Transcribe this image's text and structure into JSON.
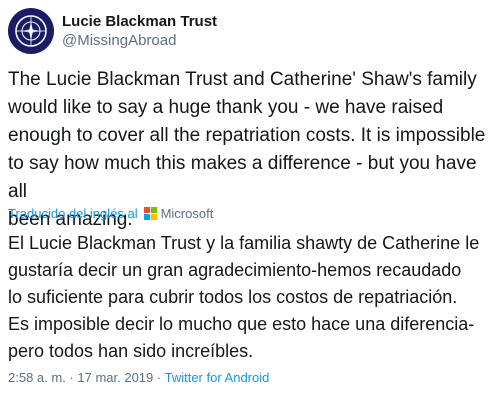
{
  "account": {
    "display_name": "Lucie Blackman Trust",
    "handle": "@MissingAbroad",
    "avatar_icon": "compass-logo-icon",
    "avatar_color": "#1a1d66"
  },
  "tweet": {
    "text": "The Lucie Blackman Trust and Catherine' Shaw's family\nwould like to say a huge thank you - we have raised\nenough to cover all the repatriation costs. It is impossible\nto say how much this makes a difference - but you have all\nbeen amazing."
  },
  "translation": {
    "translated_from_label": "Traducido del inglés al",
    "provider_name": "Microsoft",
    "provider_icon": "microsoft-logo-icon",
    "text": "El Lucie Blackman Trust y la familia shawty de Catherine le\ngustaría decir un gran agradecimiento-hemos recaudado\nlo suficiente para cubrir todos los costos de repatriación.\nEs imposible decir lo mucho que esto hace una diferencia-\npero todos han sido increíbles."
  },
  "meta": {
    "time": "2:58 a. m.",
    "separator1": " · ",
    "date": "17 mar. 2019",
    "separator2": " · ",
    "source": "Twitter for Android"
  },
  "colors": {
    "link": "#1b95e0",
    "secondary_text": "#5b7083",
    "primary_text": "#14171a"
  }
}
